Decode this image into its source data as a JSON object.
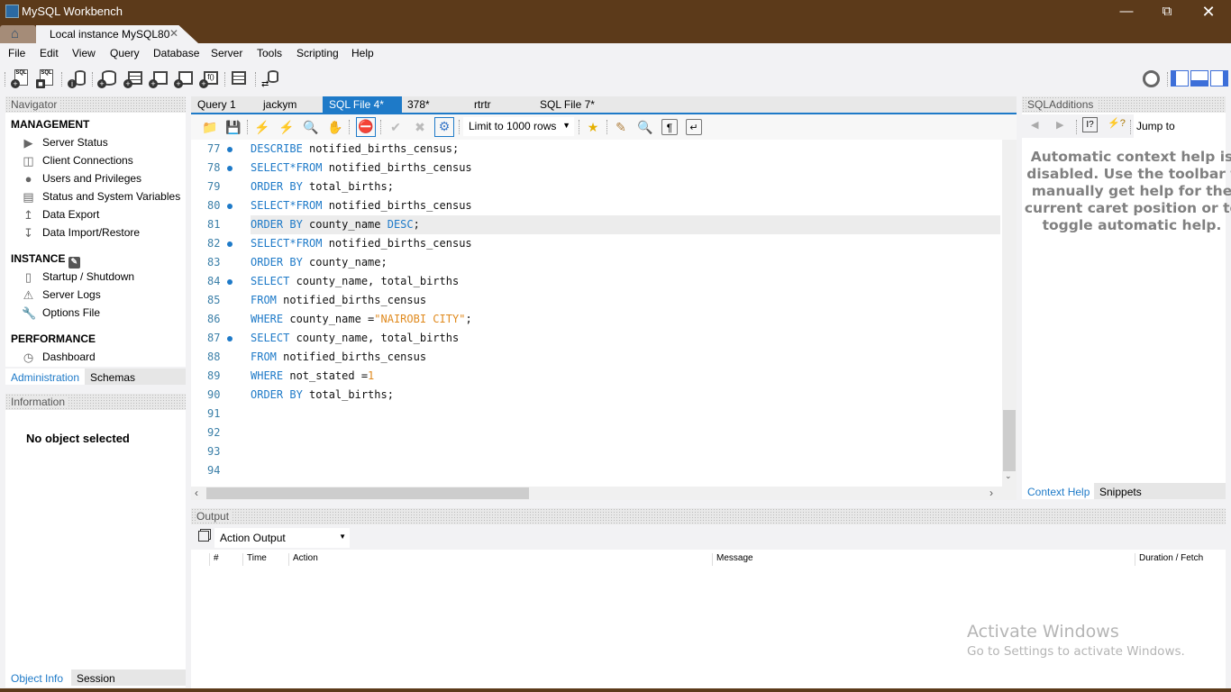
{
  "window": {
    "title": "MySQL Workbench",
    "controls": [
      "minimize",
      "restore",
      "close"
    ]
  },
  "connection_tabs": {
    "home_icon": "home-icon",
    "active_tab": "Local instance MySQL80"
  },
  "menu": [
    "File",
    "Edit",
    "View",
    "Query",
    "Database",
    "Server",
    "Tools",
    "Scripting",
    "Help"
  ],
  "main_toolbar": {
    "icons": [
      "new-sql-tab-icon",
      "open-sql-script-icon",
      "inspect-object-icon",
      "create-schema-icon",
      "create-table-icon",
      "create-view-icon",
      "create-procedure-icon",
      "create-function-icon",
      "search-table-data-icon",
      "reconnect-icon"
    ],
    "right_icons": [
      "preferences-gear-icon",
      "toggle-sidebar-icon",
      "toggle-output-icon",
      "toggle-secondary-sidebar-icon"
    ]
  },
  "navigator": {
    "title": "Navigator",
    "sections": [
      {
        "title": "MANAGEMENT",
        "items": [
          "Server Status",
          "Client Connections",
          "Users and Privileges",
          "Status and System Variables",
          "Data Export",
          "Data Import/Restore"
        ]
      },
      {
        "title": "INSTANCE",
        "items": [
          "Startup / Shutdown",
          "Server Logs",
          "Options File"
        ]
      },
      {
        "title": "PERFORMANCE",
        "items": [
          "Dashboard"
        ]
      }
    ],
    "tabs": [
      "Administration",
      "Schemas"
    ],
    "active_tab": "Administration"
  },
  "information": {
    "title": "Information",
    "message": "No object selected",
    "tabs": [
      "Object Info",
      "Session"
    ],
    "active_tab": "Object Info"
  },
  "sql_tabs": [
    {
      "label": "Query 1"
    },
    {
      "label": "jackym"
    },
    {
      "label": "SQL File 4*",
      "active": true,
      "close": "×"
    },
    {
      "label": "378*"
    },
    {
      "label": "rtrtr"
    },
    {
      "label": "SQL File 7*"
    }
  ],
  "editor_toolbar": {
    "limit_select": "Limit to 1000 rows"
  },
  "editor": {
    "highlighted_line": 81,
    "lines": [
      {
        "n": "77",
        "dot": true,
        "tokens": [
          [
            "kw",
            "DESCRIBE"
          ],
          [
            "t",
            " notified_births_census;"
          ]
        ]
      },
      {
        "n": "78",
        "dot": true,
        "tokens": [
          [
            "kw",
            "SELECT*FROM"
          ],
          [
            "t",
            " notified_births_census"
          ]
        ]
      },
      {
        "n": "79",
        "dot": false,
        "tokens": [
          [
            "kw",
            "ORDER BY"
          ],
          [
            "t",
            " total_births;"
          ]
        ]
      },
      {
        "n": "80",
        "dot": true,
        "tokens": [
          [
            "kw",
            "SELECT*FROM"
          ],
          [
            "t",
            " notified_births_census"
          ]
        ]
      },
      {
        "n": "81",
        "dot": false,
        "tokens": [
          [
            "kw",
            "ORDER BY"
          ],
          [
            "t",
            " county_name "
          ],
          [
            "kw",
            "DESC"
          ],
          [
            "t",
            ";"
          ]
        ]
      },
      {
        "n": "82",
        "dot": true,
        "tokens": [
          [
            "kw",
            "SELECT*FROM"
          ],
          [
            "t",
            " notified_births_census"
          ]
        ]
      },
      {
        "n": "83",
        "dot": false,
        "tokens": [
          [
            "kw",
            "ORDER BY"
          ],
          [
            "t",
            " county_name;"
          ]
        ]
      },
      {
        "n": "84",
        "dot": true,
        "tokens": [
          [
            "kw",
            "SELECT"
          ],
          [
            "t",
            " county_name, total_births"
          ]
        ]
      },
      {
        "n": "85",
        "dot": false,
        "tokens": [
          [
            "kw",
            "FROM"
          ],
          [
            "t",
            " notified_births_census"
          ]
        ]
      },
      {
        "n": "86",
        "dot": false,
        "tokens": [
          [
            "kw",
            "WHERE"
          ],
          [
            "t",
            " county_name ="
          ],
          [
            "str",
            "\"NAIROBI CITY\""
          ],
          [
            "t",
            ";"
          ]
        ]
      },
      {
        "n": "87",
        "dot": true,
        "tokens": [
          [
            "kw",
            "SELECT"
          ],
          [
            "t",
            " county_name, total_births"
          ]
        ]
      },
      {
        "n": "88",
        "dot": false,
        "tokens": [
          [
            "kw",
            "FROM"
          ],
          [
            "t",
            " notified_births_census"
          ]
        ]
      },
      {
        "n": "89",
        "dot": false,
        "tokens": [
          [
            "kw",
            "WHERE"
          ],
          [
            "t",
            " not_stated ="
          ],
          [
            "num",
            "1"
          ]
        ]
      },
      {
        "n": "90",
        "dot": false,
        "tokens": [
          [
            "kw",
            "ORDER BY"
          ],
          [
            "t",
            " total_births;"
          ]
        ]
      },
      {
        "n": "91",
        "dot": false,
        "tokens": []
      },
      {
        "n": "92",
        "dot": false,
        "tokens": []
      },
      {
        "n": "93",
        "dot": false,
        "tokens": []
      },
      {
        "n": "94",
        "dot": false,
        "tokens": []
      }
    ]
  },
  "sql_additions": {
    "title": "SQLAdditions",
    "jump_to": "Jump to",
    "help_lines": [
      "Automatic context help is",
      "disabled. Use the toolbar t",
      "manually get help for the",
      "current caret position or to",
      "toggle automatic help."
    ],
    "tabs": [
      "Context Help",
      "Snippets"
    ],
    "active_tab": "Context Help"
  },
  "output": {
    "title": "Output",
    "select": "Action Output",
    "columns": [
      "#",
      "Time",
      "Action",
      "Message",
      "Duration / Fetch"
    ]
  },
  "watermark": {
    "title": "Activate Windows",
    "subtitle": "Go to Settings to activate Windows."
  },
  "colors": {
    "titlebar": "#5c3a1a",
    "accent": "#1e7ac8",
    "keyword": "#1e7ac8",
    "string": "#e08a1e"
  }
}
